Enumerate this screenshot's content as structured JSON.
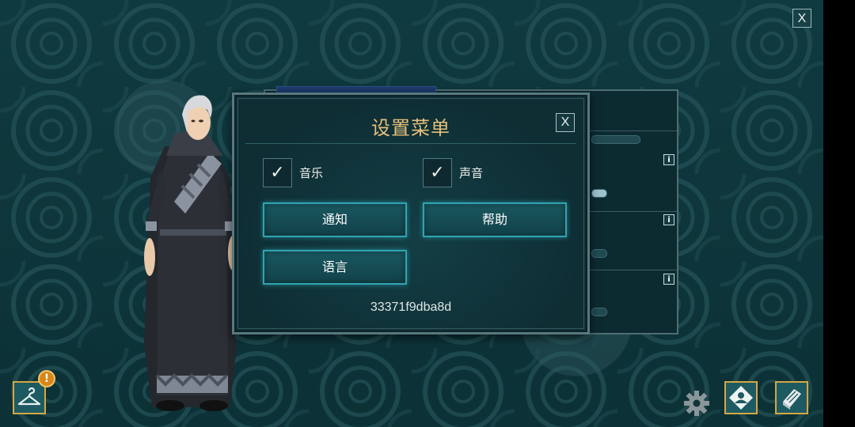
{
  "window": {
    "close_label": "X"
  },
  "settings_dialog": {
    "title": "设置菜单",
    "close_label": "X",
    "toggles": [
      {
        "label": "音乐",
        "checked": true,
        "mark": "✓"
      },
      {
        "label": "声音",
        "checked": true,
        "mark": "✓"
      }
    ],
    "buttons": {
      "notifications": "通知",
      "help": "帮助",
      "language": "语言"
    },
    "player_id": "33371f9dba8d"
  },
  "background_panel": {
    "info_icon_label": "i"
  },
  "hud": {
    "wardrobe_alert": "!",
    "icons": [
      "hanger-icon",
      "gear-icon",
      "profile-icon",
      "journal-icon"
    ]
  },
  "colors": {
    "title_gold": "#e6c07a",
    "button_glow": "#2fa4b1",
    "hud_border": "#d5a743",
    "alert_orange": "#d8861a"
  }
}
